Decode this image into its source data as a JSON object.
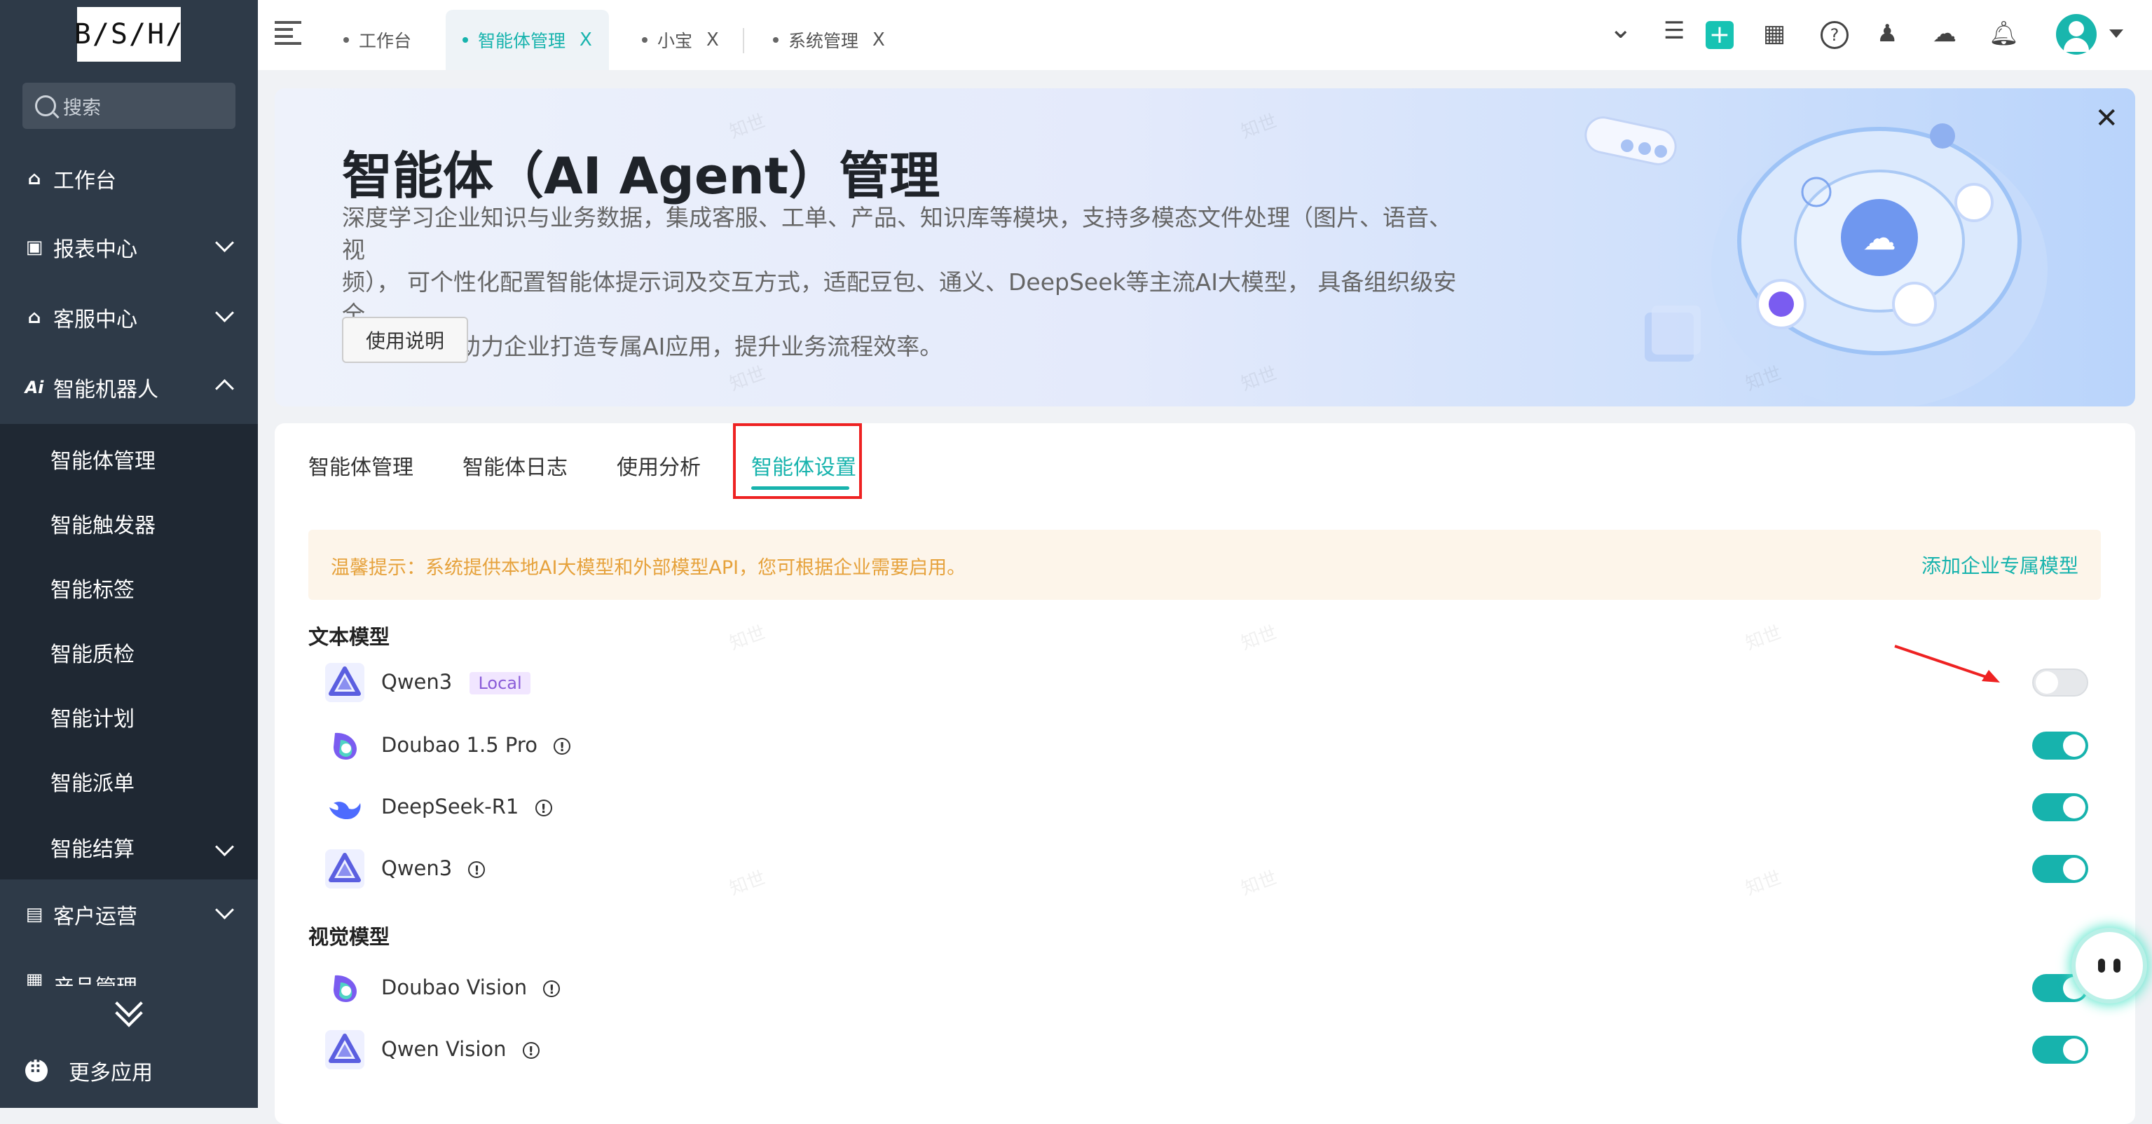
{
  "app": {
    "logo_text": "B/S/H/"
  },
  "sidebar": {
    "search_placeholder": "搜索",
    "items": [
      {
        "label": "工作台",
        "icon": "home-icon"
      },
      {
        "label": "报表中心",
        "icon": "monitor-icon"
      },
      {
        "label": "客服中心",
        "icon": "service-home-icon"
      },
      {
        "label": "智能机器人",
        "icon": "ai-icon"
      }
    ],
    "submenu": [
      "智能体管理",
      "智能触发器",
      "智能标签",
      "智能质检",
      "智能计划",
      "智能派单",
      "智能结算"
    ],
    "after": [
      {
        "label": "客户运营",
        "icon": "contact-card-icon"
      },
      {
        "label": "产品管理",
        "icon": "box-icon"
      }
    ],
    "more_apps": "更多应用"
  },
  "topbar": {
    "tabs": [
      {
        "label": "工作台",
        "active": false,
        "closable": false
      },
      {
        "label": "智能体管理",
        "active": true,
        "closable": true
      },
      {
        "label": "小宝",
        "active": false,
        "closable": true
      },
      {
        "label": "系统管理",
        "active": false,
        "closable": true
      }
    ],
    "close_glyph": "X"
  },
  "banner": {
    "title": "智能体（AI Agent）管理",
    "desc_lines": [
      "深度学习企业知识与业务数据，集成客服、工单、产品、知识库等模块，支持多模态文件处理（图片、语音、视",
      "频）， 可个性化配置智能体提示词及交互方式，适配豆包、通义、DeepSeek等主流AI大模型， 具备组织级安全",
      "权限控制，助力企业打造专属AI应用，提升业务流程效率。"
    ],
    "button": "使用说明"
  },
  "content_tabs": [
    {
      "label": "智能体管理",
      "active": false
    },
    {
      "label": "智能体日志",
      "active": false
    },
    {
      "label": "使用分析",
      "active": false
    },
    {
      "label": "智能体设置",
      "active": true
    }
  ],
  "notice": {
    "text": "温馨提示：系统提供本地AI大模型和外部模型API，您可根据企业需要启用。",
    "link": "添加企业专属模型"
  },
  "text_models": {
    "title": "文本模型",
    "items": [
      {
        "name": "Qwen3",
        "badge": "Local",
        "enabled": false,
        "logo": "qwen-logo-icon"
      },
      {
        "name": "Doubao 1.5 Pro",
        "badge": "",
        "enabled": true,
        "logo": "doubao-logo-icon"
      },
      {
        "name": "DeepSeek-R1",
        "badge": "",
        "enabled": true,
        "logo": "deepseek-logo-icon"
      },
      {
        "name": "Qwen3",
        "badge": "",
        "enabled": true,
        "logo": "qwen-logo-icon"
      }
    ]
  },
  "vision_models": {
    "title": "视觉模型",
    "items": [
      {
        "name": "Doubao Vision",
        "badge": "",
        "enabled": true,
        "logo": "doubao-logo-icon"
      },
      {
        "name": "Qwen Vision",
        "badge": "",
        "enabled": true,
        "logo": "qwen-logo-icon"
      }
    ]
  },
  "watermark": "知世",
  "colors": {
    "accent": "#17b3ad",
    "sidebar": "#2e3a48",
    "warning": "#e6a23c",
    "highlight": "#ee2222"
  }
}
